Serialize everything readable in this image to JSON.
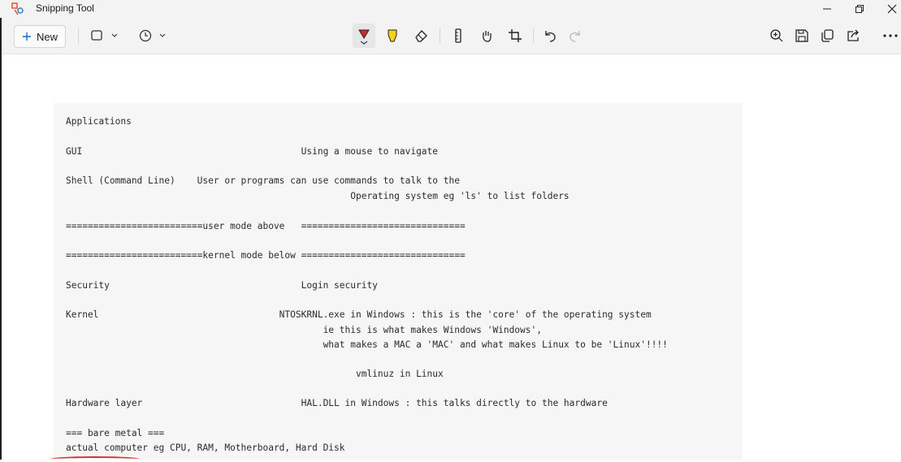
{
  "window": {
    "title": "Snipping Tool"
  },
  "toolbar": {
    "new_label": "New",
    "tools": [
      "snip-mode-icon",
      "delay-icon",
      "ballpoint-pen-icon",
      "highlighter-icon",
      "eraser-icon",
      "ruler-icon",
      "touch-writing-icon",
      "crop-icon",
      "undo-icon",
      "redo-icon",
      "zoom-icon",
      "save-icon",
      "copy-icon",
      "share-icon",
      "more-icon"
    ]
  },
  "document": {
    "lines": [
      "Applications",
      "GUI                                        Using a mouse to navigate",
      "Shell (Command Line)    User or programs can use commands to talk to the",
      "                                                    Operating system eg 'ls' to list folders",
      "=========================user mode above   ==============================",
      "=========================kernel mode below ==============================",
      "Security                                   Login security",
      "Kernel                                 NTOSKRNL.exe in Windows : this is the 'core' of the operating system",
      "                                               ie this is what makes Windows 'Windows',",
      "                                               what makes a MAC a 'MAC' and what makes Linux to be 'Linux'!!!!",
      "                                                     vmlinuz in Linux",
      "Hardware layer                             HAL.DLL in Windows : this talks directly to the hardware",
      "=== bare metal ===",
      "actual computer eg CPU, RAM, Motherboard, Hard Disk"
    ]
  }
}
